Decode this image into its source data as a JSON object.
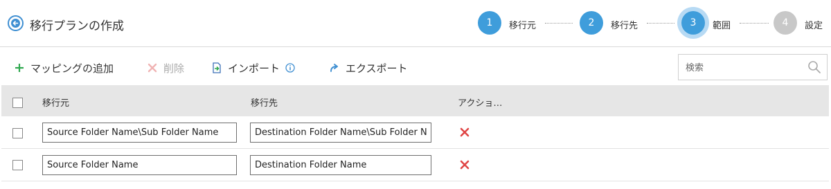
{
  "header": {
    "title": "移行プランの作成"
  },
  "steps": [
    {
      "number": "1",
      "label": "移行元",
      "state": "done"
    },
    {
      "number": "2",
      "label": "移行先",
      "state": "done"
    },
    {
      "number": "3",
      "label": "範囲",
      "state": "current"
    },
    {
      "number": "4",
      "label": "設定",
      "state": "todo"
    }
  ],
  "toolbar": {
    "add_label": "マッピングの追加",
    "delete_label": "削除",
    "import_label": "インポート",
    "export_label": "エクスポート"
  },
  "search": {
    "placeholder": "検索"
  },
  "table": {
    "columns": [
      "移行元",
      "移行先",
      "アクショ…"
    ],
    "rows": [
      {
        "source": "Source Folder Name\\Sub Folder Name",
        "destination": "Destination Folder Name\\Sub Folder Name"
      },
      {
        "source": "Source Folder Name",
        "destination": "Destination Folder Name"
      }
    ]
  },
  "colors": {
    "accent": "#3f9ddb",
    "add_icon": "#2fa84f",
    "delete_icon": "#e04545",
    "todo_step": "#c8c8c8"
  }
}
